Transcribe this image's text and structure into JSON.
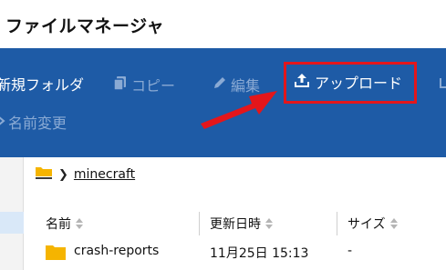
{
  "app": {
    "title": "ファイルマネージャ"
  },
  "toolbar": {
    "new_folder_label": "新規フォルダ",
    "copy_label": "コピー",
    "edit_label": "編集",
    "upload_label": "アップロード",
    "rename_label": "名前変更"
  },
  "breadcrumb": {
    "current": "minecraft"
  },
  "table": {
    "columns": [
      {
        "label": "名前"
      },
      {
        "label": "更新日時"
      },
      {
        "label": "サイズ"
      }
    ],
    "rows": [
      {
        "name": "crash-reports",
        "modified": "11月25日 15:13",
        "size": "-"
      }
    ]
  },
  "colors": {
    "toolbar_bg": "#1e5ba6",
    "highlight_red": "#e4161b",
    "folder_yellow": "#f5b400"
  }
}
